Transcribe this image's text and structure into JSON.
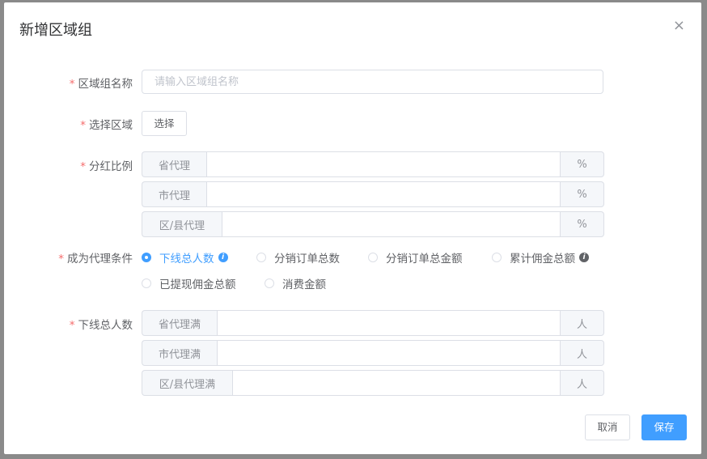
{
  "dialog": {
    "title": "新增区域组",
    "close_glyph": "×"
  },
  "form": {
    "group_name": {
      "label": "区域组名称",
      "placeholder": "请输入区域组名称",
      "required_mark": "*"
    },
    "region": {
      "label": "选择区域",
      "button": "选择",
      "required_mark": "*"
    },
    "dividend": {
      "label": "分红比例",
      "required_mark": "*",
      "rows": [
        {
          "prepend": "省代理",
          "value": "",
          "append": "%"
        },
        {
          "prepend": "市代理",
          "value": "",
          "append": "%"
        },
        {
          "prepend": "区/县代理",
          "value": "",
          "append": "%"
        }
      ]
    },
    "condition": {
      "label": "成为代理条件",
      "required_mark": "*",
      "selected": "下线总人数",
      "options": [
        "下线总人数",
        "分销订单总数",
        "分销订单总金额",
        "累计佣金总额",
        "已提现佣金总额",
        "消费金额"
      ]
    },
    "downline": {
      "label": "下线总人数",
      "required_mark": "*",
      "rows": [
        {
          "prepend": "省代理满",
          "value": "",
          "append": "人"
        },
        {
          "prepend": "市代理满",
          "value": "",
          "append": "人"
        },
        {
          "prepend": "区/县代理满",
          "value": "",
          "append": "人"
        }
      ]
    }
  },
  "footer": {
    "cancel": "取消",
    "save": "保存"
  },
  "colors": {
    "primary": "#409eff",
    "required": "#f56c6c",
    "info_icon_blue": "#409eff",
    "info_icon_dark": "#606266"
  }
}
